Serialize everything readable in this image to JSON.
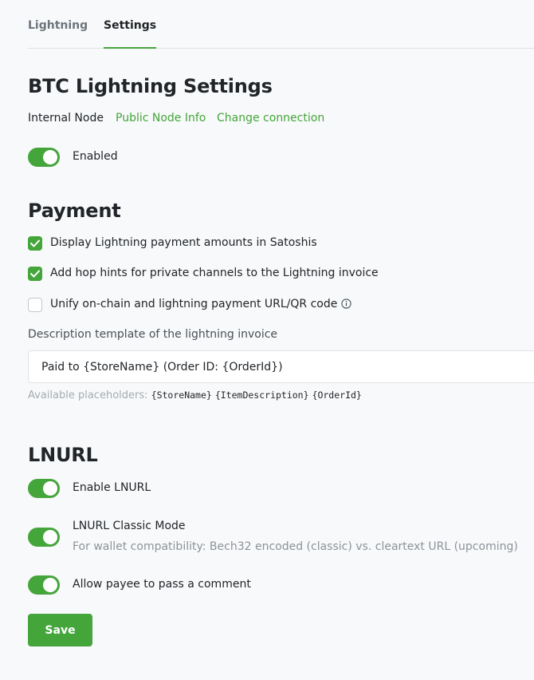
{
  "tabs": [
    {
      "label": "Lightning"
    },
    {
      "label": "Settings"
    }
  ],
  "title": "BTC Lightning Settings",
  "node": {
    "internal_label": "Internal Node",
    "public_info_link": "Public Node Info",
    "change_connection_link": "Change connection"
  },
  "enabled": {
    "label": "Enabled",
    "checked": true
  },
  "payment": {
    "heading": "Payment",
    "options": [
      {
        "label": "Display Lightning payment amounts in Satoshis",
        "checked": true
      },
      {
        "label": "Add hop hints for private channels to the Lightning invoice",
        "checked": true
      },
      {
        "label": "Unify on-chain and lightning payment URL/QR code",
        "checked": false,
        "icon": "info-icon"
      }
    ],
    "description": {
      "label": "Description template of the lightning invoice",
      "value": "Paid to {StoreName} (Order ID: {OrderId})"
    },
    "placeholders": {
      "label": "Available placeholders:",
      "items": [
        "{StoreName}",
        "{ItemDescription}",
        "{OrderId}"
      ]
    }
  },
  "lnurl": {
    "heading": "LNURL",
    "enable": {
      "label": "Enable LNURL",
      "checked": true
    },
    "classic": {
      "label": "LNURL Classic Mode",
      "help": "For wallet compatibility: Bech32 encoded (classic) vs. cleartext URL (upcoming)",
      "checked": true
    },
    "comment": {
      "label": "Allow payee to pass a comment",
      "checked": true
    }
  },
  "save_label": "Save",
  "colors": {
    "accent": "#44a53b",
    "background": "#f8f9fa",
    "text": "#212529",
    "muted": "#8d939a"
  }
}
